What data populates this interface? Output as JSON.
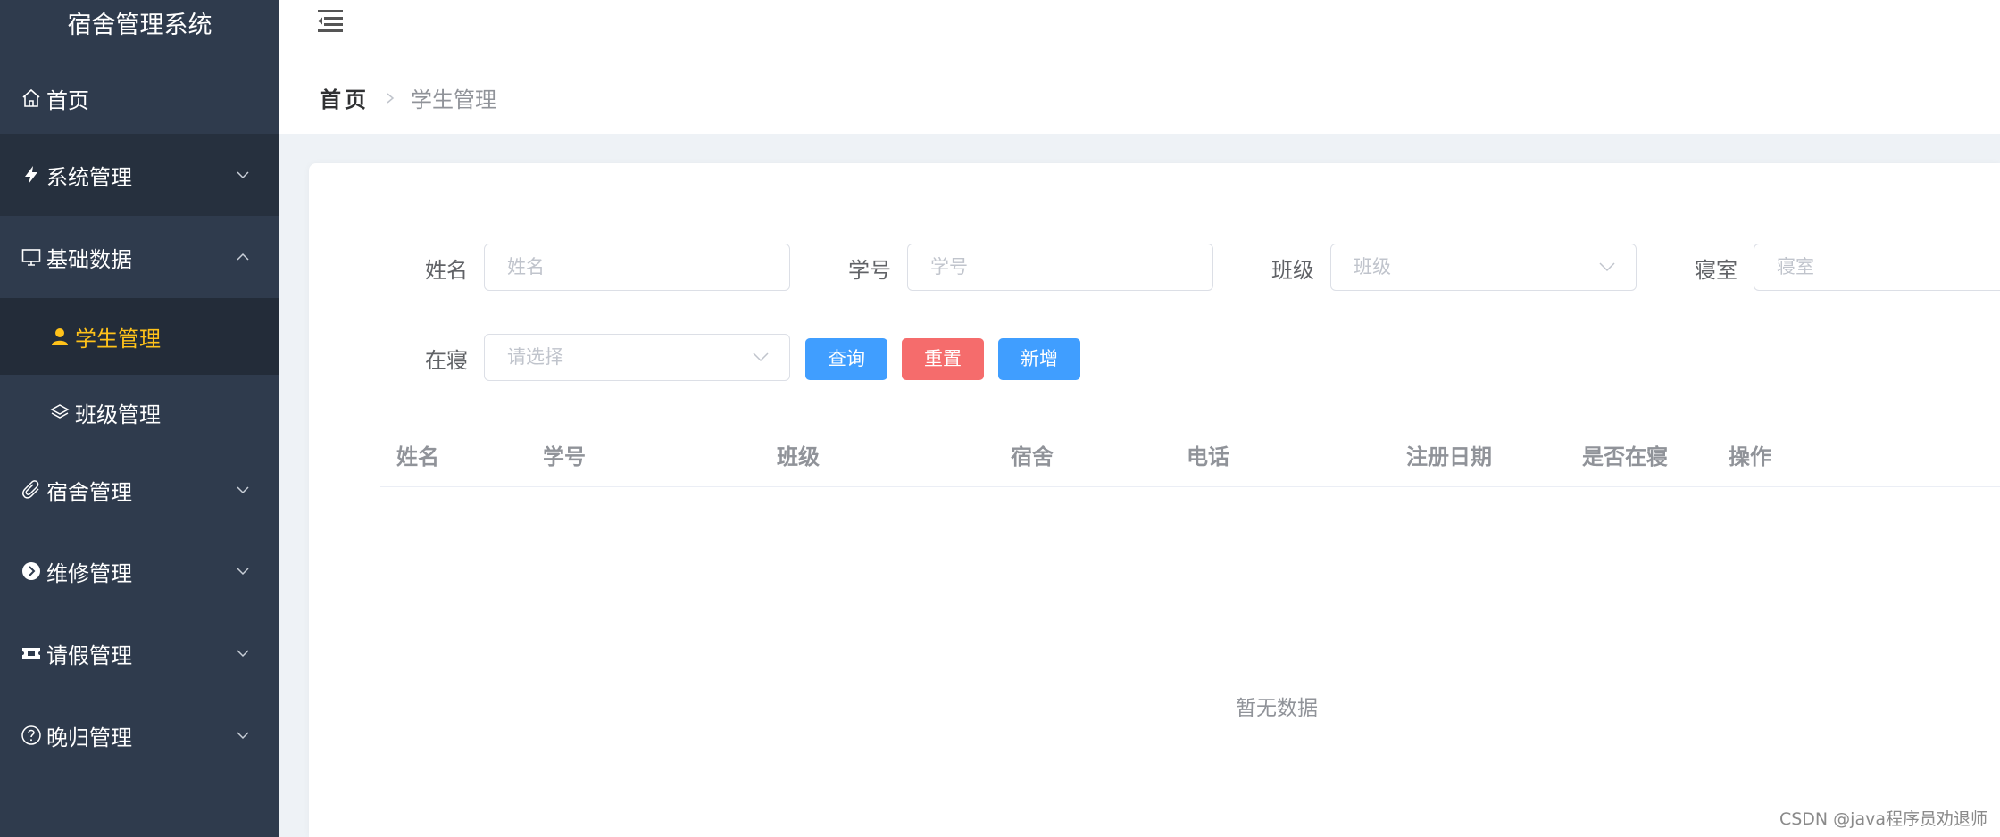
{
  "sidebar": {
    "title": "宿舍管理系统",
    "items": [
      {
        "label": "首页",
        "icon": "home-icon"
      },
      {
        "label": "系统管理",
        "icon": "lightning-icon"
      },
      {
        "label": "基础数据",
        "icon": "monitor-icon"
      },
      {
        "label": "学生管理",
        "icon": "user-icon"
      },
      {
        "label": "班级管理",
        "icon": "layers-icon"
      },
      {
        "label": "宿舍管理",
        "icon": "paperclip-icon"
      },
      {
        "label": "维修管理",
        "icon": "circle-arrow-icon"
      },
      {
        "label": "请假管理",
        "icon": "ticket-icon"
      },
      {
        "label": "晚归管理",
        "icon": "question-circle-icon"
      }
    ],
    "active_color": "#ffc21a"
  },
  "breadcrumb": {
    "home": "首页",
    "current": "学生管理"
  },
  "form": {
    "name_label": "姓名",
    "name_placeholder": "姓名",
    "id_label": "学号",
    "id_placeholder": "学号",
    "class_label": "班级",
    "class_placeholder": "班级",
    "room_label": "寝室",
    "room_placeholder": "寝室",
    "inroom_label": "在寝",
    "inroom_placeholder": "请选择",
    "query_label": "查询",
    "reset_label": "重置",
    "add_label": "新增"
  },
  "table": {
    "columns": [
      "姓名",
      "学号",
      "班级",
      "宿舍",
      "电话",
      "注册日期",
      "是否在寝",
      "操作"
    ],
    "empty_text": "暂无数据"
  },
  "watermark": "CSDN @java程序员劝退师"
}
